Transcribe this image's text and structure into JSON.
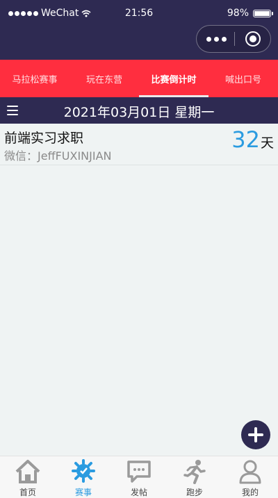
{
  "status_bar": {
    "carrier": "WeChat",
    "time": "21:56",
    "battery": "98%",
    "battery_level": 0.98
  },
  "capsule": {
    "more_icon": "more-icon",
    "close_icon": "target-icon"
  },
  "tabs": [
    {
      "label": "马拉松赛事",
      "active": false
    },
    {
      "label": "玩在东营",
      "active": false
    },
    {
      "label": "比赛倒计时",
      "active": true
    },
    {
      "label": "喊出口号",
      "active": false
    }
  ],
  "date_bar": {
    "date": "2021年03月01日 星期一",
    "menu_icon": "menu-icon"
  },
  "items": [
    {
      "title": "前端实习求职",
      "subtitle": "微信：JeffFUXINJIAN",
      "days": "32",
      "unit": "天"
    }
  ],
  "fab": {
    "icon": "plus-icon"
  },
  "tabbar": [
    {
      "label": "首页",
      "icon": "home-icon",
      "active": false
    },
    {
      "label": "赛事",
      "icon": "event-icon",
      "active": true
    },
    {
      "label": "发帖",
      "icon": "post-icon",
      "active": false
    },
    {
      "label": "跑步",
      "icon": "run-icon",
      "active": false
    },
    {
      "label": "我的",
      "icon": "profile-icon",
      "active": false
    }
  ],
  "colors": {
    "header": "#2e2a52",
    "tab_bar": "#ff2e3f",
    "accent": "#2a9be0",
    "background": "#eff3f3"
  }
}
